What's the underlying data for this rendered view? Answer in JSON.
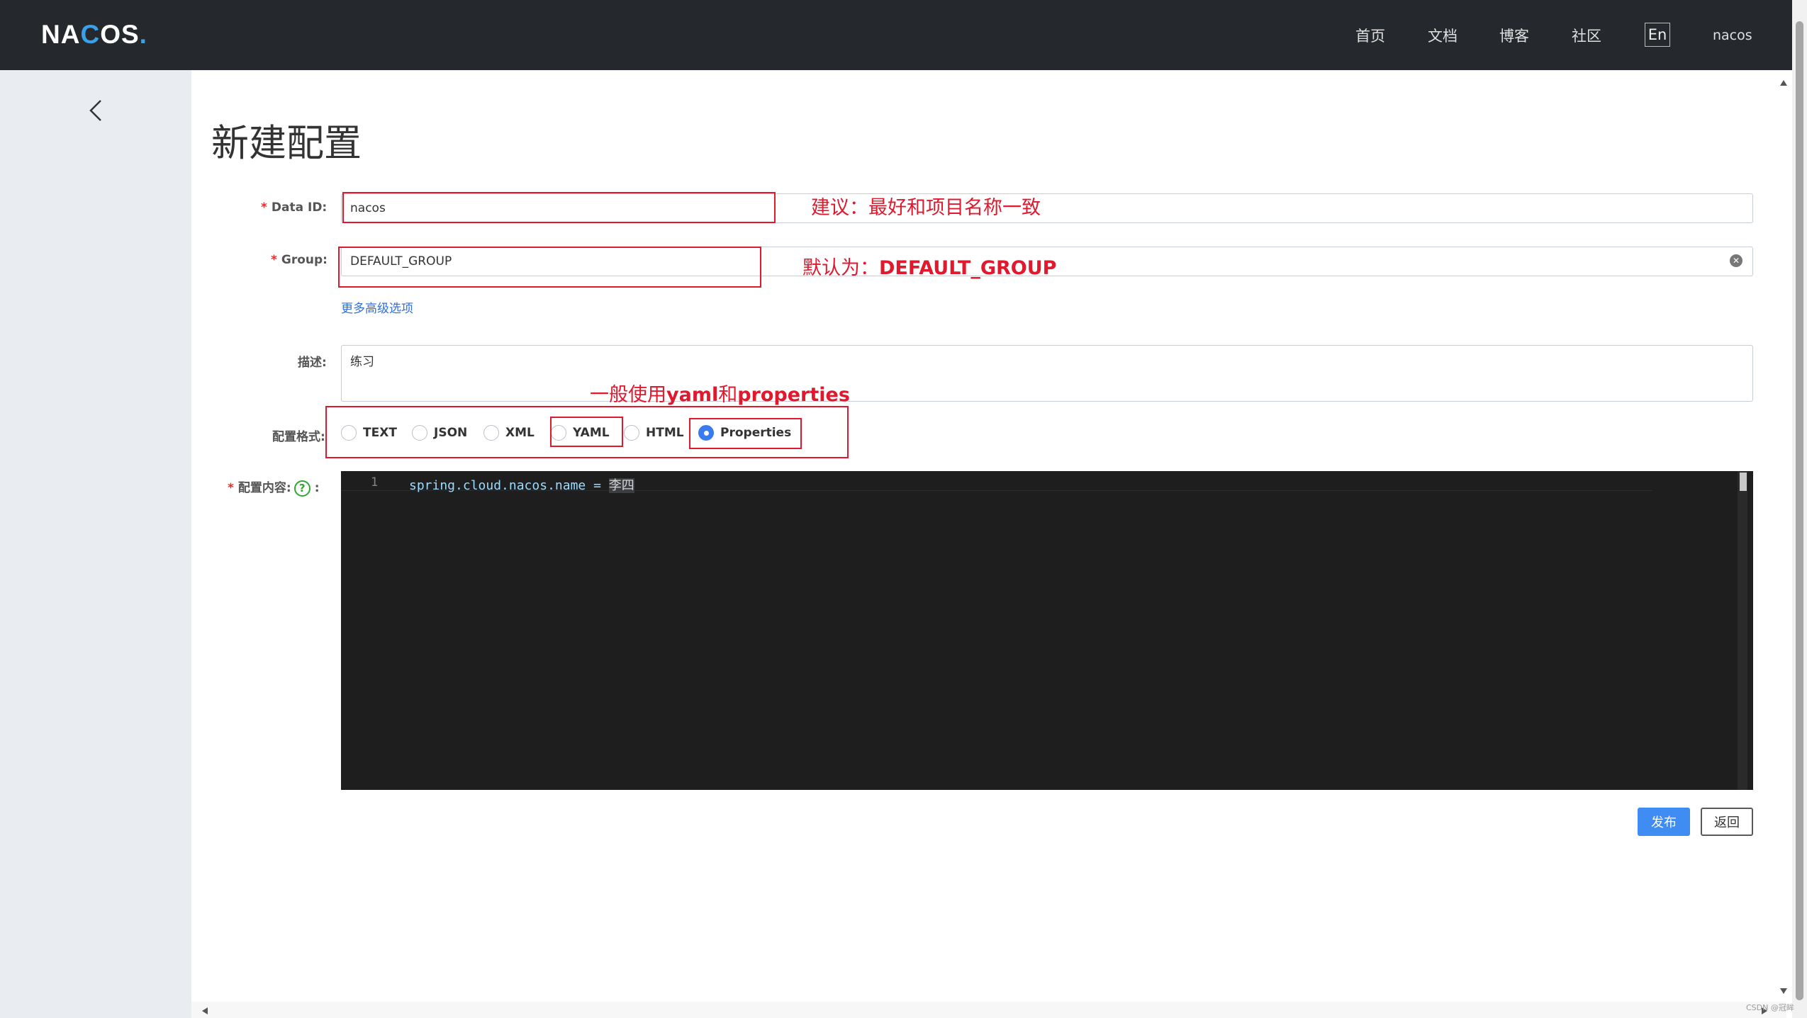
{
  "header": {
    "logo": {
      "text_na": "NA",
      "text_c": "C",
      "text_os": "OS",
      "text_dot": "."
    },
    "nav": {
      "home": "首页",
      "docs": "文档",
      "blog": "博客",
      "community": "社区",
      "lang": "En",
      "user": "nacos"
    }
  },
  "page": {
    "title": "新建配置"
  },
  "form": {
    "data_id": {
      "required_mark": "*",
      "label": "Data ID:",
      "value": "nacos"
    },
    "group": {
      "required_mark": "*",
      "label": "Group:",
      "value": "DEFAULT_GROUP"
    },
    "more_options": "更多高级选项",
    "description": {
      "label": "描述:",
      "value": "练习"
    },
    "format": {
      "label": "配置格式:",
      "options": [
        "TEXT",
        "JSON",
        "XML",
        "YAML",
        "HTML",
        "Properties"
      ],
      "selected": "Properties"
    },
    "content": {
      "required_mark": "*",
      "label": "配置内容:",
      "help_glyph": "?",
      "colon": ":",
      "line_number": "1",
      "code_key": "spring.cloud.nacos.name = ",
      "code_value": "李四"
    }
  },
  "annotations": {
    "data_id_tip": "建议：最好和项目名称一致",
    "group_tip_prefix": "默认为：",
    "group_tip_value": "DEFAULT_GROUP",
    "format_tip_1": "一般使用",
    "format_tip_yaml": "yaml",
    "format_tip_and": "和",
    "format_tip_properties": "properties"
  },
  "buttons": {
    "publish": "发布",
    "back": "返回"
  },
  "watermark": "CSDN @冠眸"
}
